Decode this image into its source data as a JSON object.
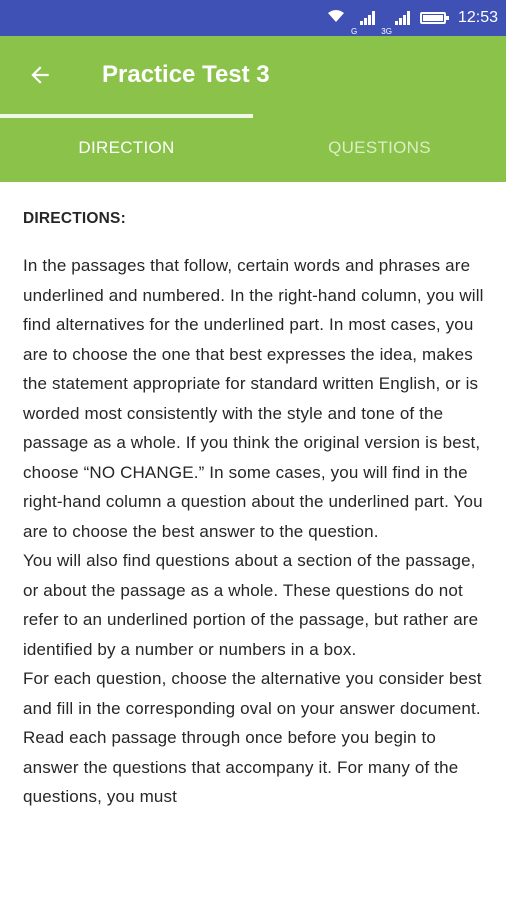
{
  "status_bar": {
    "network_1": "G",
    "network_2": "3G",
    "time": "12:53",
    "battery_level": 0.9
  },
  "app_bar": {
    "title": "Practice Test 3",
    "back_icon": "arrow-back-icon"
  },
  "tabs": [
    {
      "label": "DIRECTION",
      "selected": true
    },
    {
      "label": "QUESTIONS",
      "selected": false
    }
  ],
  "content": {
    "heading": "DIRECTIONS:",
    "paragraphs": [
      "In the passages that follow, certain words and phrases are underlined and numbered. In the right-hand column, you will find alternatives for the underlined part. In most cases, you are to choose the one that best expresses the idea, makes the statement appropriate for standard written English, or is worded most consistently with the style and tone of the passage as a whole. If you think the original version is best, choose “NO CHANGE.” In some cases, you will find in the right-hand column a question about the underlined part. You are to choose the best answer to the question.",
      "You will also find questions about a section of the passage, or about the passage as a whole. These questions do not refer to an underlined portion of the passage, but rather are identified by a number or numbers in a box.",
      "For each question, choose the alternative you consider best and fill in the corresponding oval on your answer document. Read each passage through once before you begin to answer the questions that accompany it. For many of the questions, you must"
    ]
  },
  "colors": {
    "status_bar": "#3f51b5",
    "app_bar": "#8bc34a",
    "text": "#262626"
  }
}
